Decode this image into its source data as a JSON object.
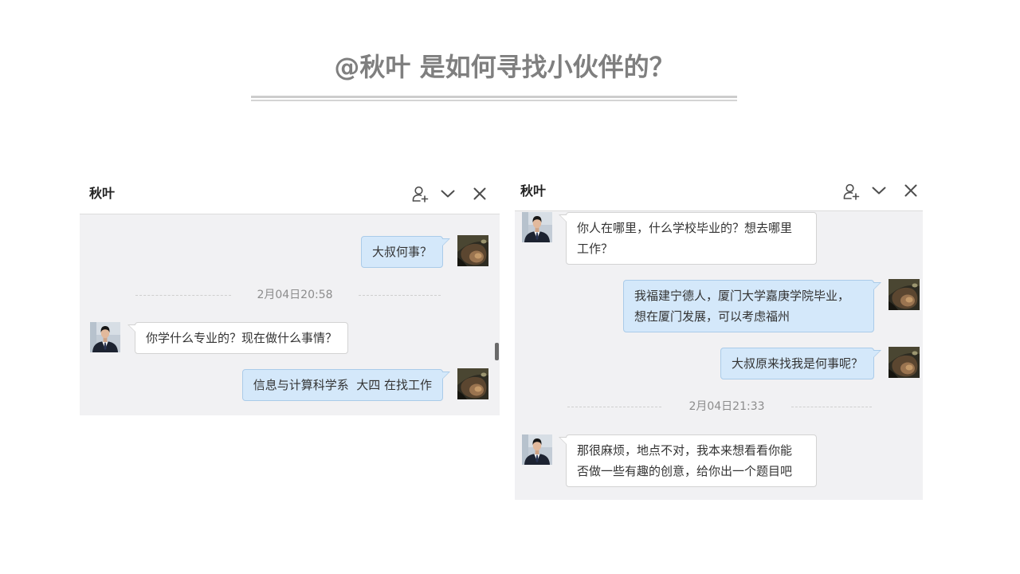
{
  "slide": {
    "title": "@秋叶 是如何寻找小伙伴的？"
  },
  "colors": {
    "title": "#7f7f7f",
    "chat_background": "#f1f1f3",
    "sent_bubble": "#d4e8fa",
    "sent_bubble_border": "#aacbe9",
    "received_bubble": "#ffffff",
    "received_bubble_border": "#d3d3d3"
  },
  "chat_left": {
    "contact_name": "秋叶",
    "header_icons": [
      "add-contact-icon",
      "chevron-down-icon",
      "close-icon"
    ],
    "messages": [
      {
        "outgoing": true,
        "lines": [
          "大叔何事？"
        ]
      },
      {
        "timestamp": "2月04日20:58"
      },
      {
        "outgoing": false,
        "lines": [
          "你学什么专业的？现在做什么事情？"
        ]
      },
      {
        "outgoing": true,
        "lines": [
          "信息与计算科学系  大四 在找工作"
        ]
      }
    ]
  },
  "chat_right": {
    "contact_name": "秋叶",
    "header_icons": [
      "add-contact-icon",
      "chevron-down-icon",
      "close-icon"
    ],
    "messages": [
      {
        "outgoing": false,
        "lines": [
          "你人在哪里，什么学校毕业的？想去哪里",
          "工作？"
        ]
      },
      {
        "outgoing": true,
        "lines": [
          "我福建宁德人，厦门大学嘉庚学院毕业，",
          "想在厦门发展，可以考虑福州"
        ]
      },
      {
        "outgoing": true,
        "lines": [
          "大叔原来找我是何事呢？"
        ]
      },
      {
        "timestamp": "2月04日21:33"
      },
      {
        "outgoing": false,
        "lines": [
          "那很麻烦，地点不对，我本来想看看你能",
          "否做一些有趣的创意，给你出一个题目吧"
        ]
      }
    ]
  }
}
